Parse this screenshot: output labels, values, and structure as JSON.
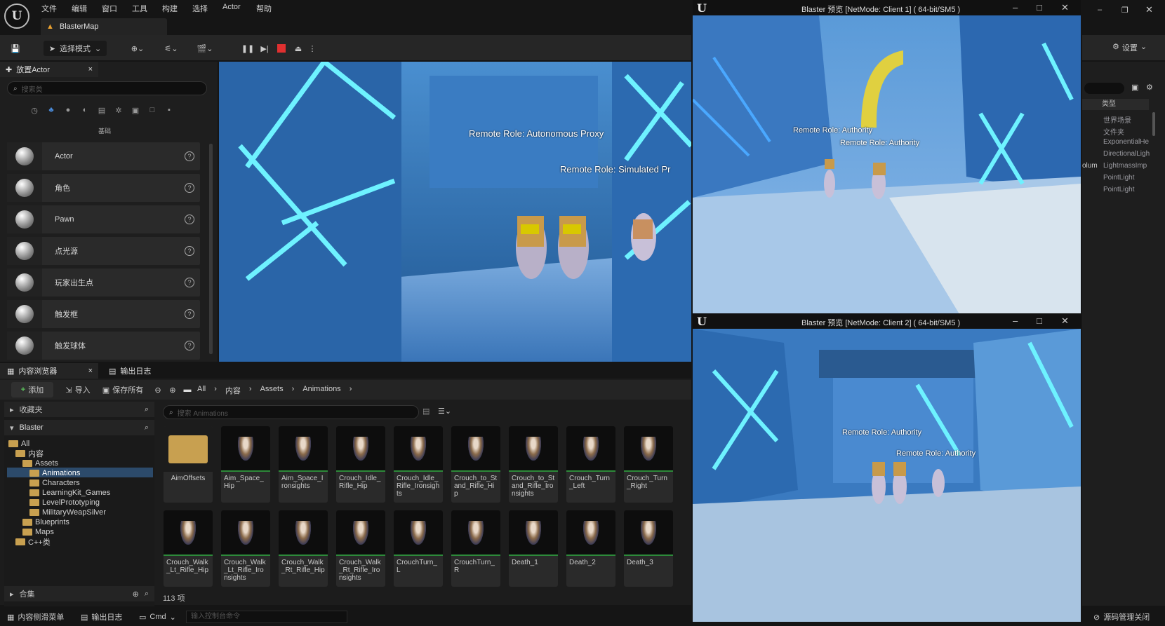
{
  "menu": [
    "文件",
    "编辑",
    "窗口",
    "工具",
    "构建",
    "选择",
    "Actor",
    "帮助"
  ],
  "map_tab": "BlasterMap",
  "toolbar": {
    "select_mode": "选择模式",
    "settings": "设置"
  },
  "place_actor": {
    "tab": "放置Actor",
    "search_placeholder": "搜索类",
    "category": "基础",
    "items": [
      "Actor",
      "角色",
      "Pawn",
      "点光源",
      "玩家出生点",
      "触发框",
      "触发球体"
    ]
  },
  "viewport": {
    "label1": "Remote Role: Autonomous Proxy",
    "label1b": "Remote Role: Simulated Proxy",
    "label2": "Remote Role: Simulated Pr"
  },
  "content_browser": {
    "tab": "内容浏览器",
    "log_tab": "输出日志",
    "add": "添加",
    "import": "导入",
    "save_all": "保存所有",
    "breadcrumb": [
      "All",
      "内容",
      "Assets",
      "Animations"
    ],
    "favorites": "收藏夹",
    "project": "Blaster",
    "search_placeholder": "搜索 Animations",
    "tree": [
      "All",
      "内容",
      "Assets",
      "Animations",
      "Characters",
      "LearningKit_Games",
      "LevelPrototyping",
      "MilitaryWeapSilver",
      "Blueprints",
      "Maps",
      "C++类"
    ],
    "collections": "合集",
    "count": "113 项",
    "assets_row1": [
      "AimOffsets",
      "Aim_Space_Hip",
      "Aim_Space_Ironsights",
      "Crouch_Idle_Rifle_Hip",
      "Crouch_Idle_Rifle_Ironsights",
      "Crouch_to_Stand_Rifle_Hip",
      "Crouch_to_Stand_Rifle_Ironsights",
      "Crouch_Turn_Left",
      "Crouch_Turn_Right"
    ],
    "assets_row2": [
      "Crouch_Walk_Lt_Rifle_Hip",
      "Crouch_Walk_Lt_Rifle_Ironsights",
      "Crouch_Walk_Rt_Rifle_Hip",
      "Crouch_Walk_Rt_Rifle_Ironsights",
      "CrouchTurn_L",
      "CrouchTurn_R",
      "Death_1",
      "Death_2",
      "Death_3"
    ]
  },
  "status": {
    "drawer": "内容侧滑菜单",
    "log": "输出日志",
    "cmd": "Cmd",
    "cmd_placeholder": "输入控制台命令",
    "source_control": "源码管理关闭"
  },
  "client1": {
    "title": "Blaster 预览 [NetMode: Client 1]  ( 64-bit/SM5 )",
    "label_a": "Remote Role: Authority",
    "label_b": "Remote Role: Authority"
  },
  "client2": {
    "title": "Blaster 预览 [NetMode: Client 2]  ( 64-bit/SM5 )",
    "label_a": "Remote Role: Authority",
    "label_b": "Remote Role: Authority"
  },
  "outliner": {
    "header": "类型",
    "col": "olum",
    "items": [
      "世界场景",
      "文件夹",
      "ExponentialHe",
      "DirectionalLigh",
      "LightmassImp",
      "PointLight",
      "PointLight"
    ]
  }
}
